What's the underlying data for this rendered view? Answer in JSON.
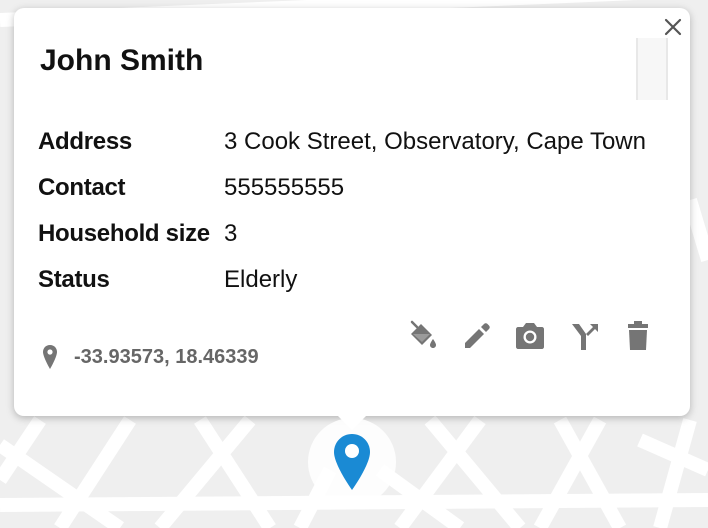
{
  "popup": {
    "title": "John Smith",
    "fields": [
      {
        "label": "Address",
        "value": "3 Cook Street, Observatory, Cape Town"
      },
      {
        "label": "Contact",
        "value": "555555555"
      },
      {
        "label": "Household size",
        "value": "3"
      },
      {
        "label": "Status",
        "value": "Elderly"
      }
    ],
    "coordinates": "-33.93573, 18.46339",
    "close_icon": "close-icon",
    "actions": [
      {
        "name": "paint-bucket-icon"
      },
      {
        "name": "pencil-icon"
      },
      {
        "name": "camera-icon"
      },
      {
        "name": "merge-icon"
      },
      {
        "name": "trash-icon"
      }
    ]
  },
  "colors": {
    "map_background": "#efefef",
    "map_roads": "#ffffff",
    "icon_gray": "#757575",
    "marker_blue": "#1a8ad4"
  }
}
